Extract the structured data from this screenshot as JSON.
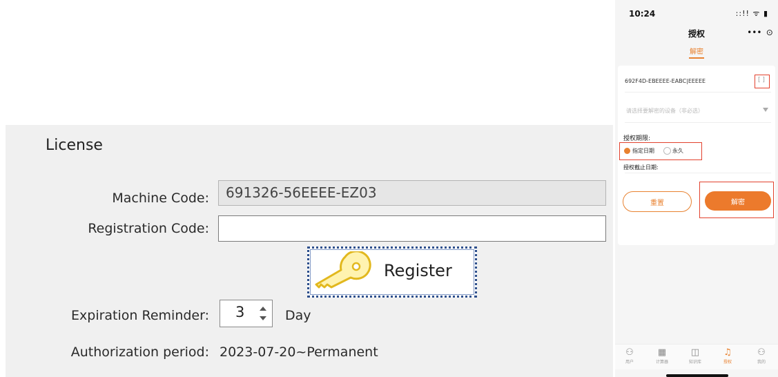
{
  "license": {
    "title": "License",
    "machine_code_label": "Machine Code:",
    "machine_code_value": "691326-56EEEE-EZ03",
    "registration_code_label": "Registration Code:",
    "registration_code_value": "",
    "register_button_label": "Register",
    "expiration_reminder_label": "Expiration Reminder:",
    "expiration_reminder_value": "3",
    "expiration_reminder_unit": "Day",
    "authorization_period_label": "Authorization period:",
    "authorization_period_value": "2023-07-20~Permanent"
  },
  "phone": {
    "status": {
      "time": "10:24",
      "icons": "::!! ᯤ ▮"
    },
    "nav_title": "授权",
    "capsule_more": "•••",
    "capsule_close": "⊙",
    "sub_tab": "解密",
    "device_id": "692F4D-EBEEEE-EABC|EEEEE",
    "scan_icon": "[ ]",
    "device_select_placeholder": "请选择要解密的设备（非必选）",
    "period_label": "授权期限:",
    "radio_specified": "指定日期",
    "radio_forever": "永久",
    "deadline_label": "授权截止日期:",
    "reset_button": "重置",
    "decrypt_button": "解密",
    "tabs": [
      {
        "label": "用户",
        "icon": "user-icon",
        "glyph": "⚇"
      },
      {
        "label": "计算器",
        "icon": "calculator-icon",
        "glyph": "▦"
      },
      {
        "label": "知识库",
        "icon": "book-icon",
        "glyph": "◫"
      },
      {
        "label": "授权",
        "icon": "bell-icon",
        "glyph": "♫",
        "active": true
      },
      {
        "label": "我的",
        "icon": "profile-icon",
        "glyph": "⚇"
      }
    ],
    "accent_color": "#e8812f",
    "highlight_color": "#e2402c"
  }
}
